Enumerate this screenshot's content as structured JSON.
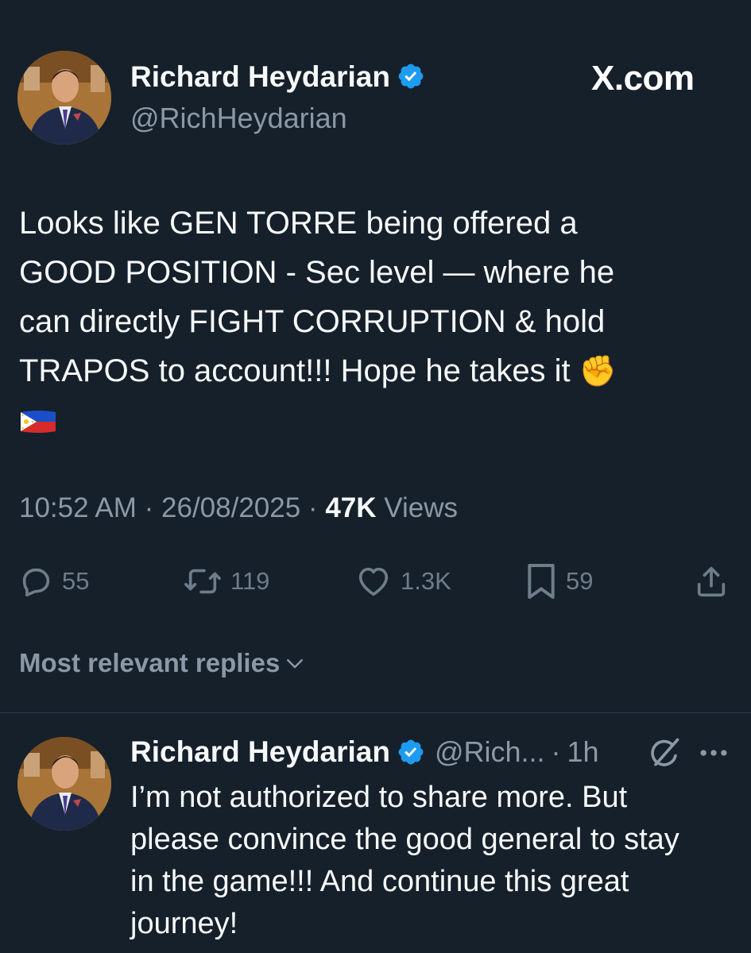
{
  "brand": "X.com",
  "tweet": {
    "author_name": "Richard Heydarian",
    "author_handle": "@RichHeydarian",
    "text_lines": [
      "Looks like GEN TORRE being offered a",
      "GOOD POSITION - Sec level — where he",
      "can directly FIGHT CORRUPTION & hold",
      "TRAPOS to account!!! Hope he takes it"
    ],
    "emoji_fist": "✊",
    "time": "10:52 AM",
    "separator": "·",
    "date": "26/08/2025",
    "views_count": "47K",
    "views_label": "Views",
    "replies": "55",
    "reposts": "119",
    "likes": "1.3K",
    "bookmarks": "59"
  },
  "replies_sort_label": "Most relevant replies",
  "reply": {
    "author_name": "Richard Heydarian",
    "author_handle": "@Rich...",
    "separator": "·",
    "time": "1h",
    "text_lines": [
      "I’m not authorized to share more. But",
      "please convince the good general to stay",
      "in the game!!! And continue this great",
      "journey!"
    ]
  },
  "icons": {
    "verified": "verified-badge-icon",
    "reply": "reply-icon",
    "repost": "repost-icon",
    "like": "heart-icon",
    "bookmark": "bookmark-icon",
    "share": "share-icon",
    "grok": "grok-icon",
    "more": "more-dots-icon",
    "chevron": "chevron-down-icon",
    "flag": "philippines-flag-icon"
  },
  "colors": {
    "background": "#15202b",
    "text": "#f7f9f9",
    "muted": "#8b98a5",
    "verified": "#1d9bf0"
  }
}
